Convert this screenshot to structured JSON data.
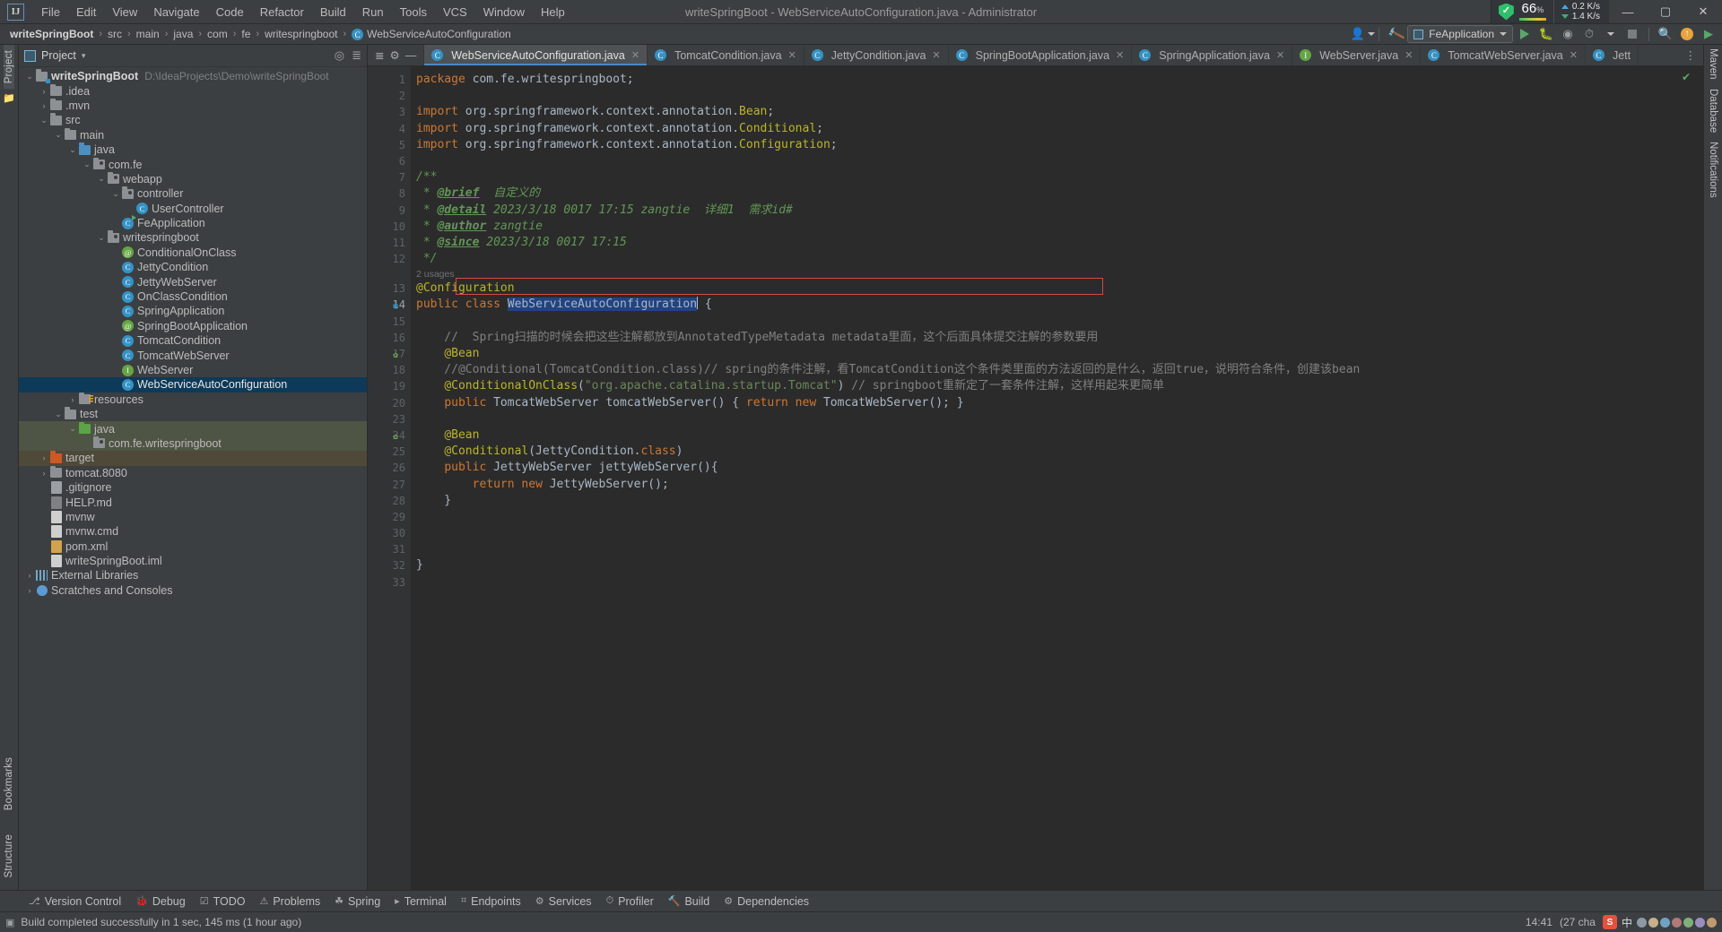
{
  "window": {
    "title": "writeSpringBoot - WebServiceAutoConfiguration.java - Administrator",
    "minimize": "—",
    "maximize": "▢",
    "close": "✕"
  },
  "menu": [
    "File",
    "Edit",
    "View",
    "Navigate",
    "Code",
    "Refactor",
    "Build",
    "Run",
    "Tools",
    "VCS",
    "Window",
    "Help"
  ],
  "system_widgets": {
    "security_icon": "shield-check-icon",
    "cpu_percent": "66",
    "cpu_unit": "%",
    "net_up": "0.2 K/s",
    "net_down": "1.4 K/s"
  },
  "breadcrumb": {
    "items": [
      "writeSpringBoot",
      "src",
      "main",
      "java",
      "com",
      "fe",
      "writespringboot"
    ],
    "separator": "›",
    "current_class": "WebServiceAutoConfiguration",
    "class_badge": "C"
  },
  "toolbar": {
    "user_icon": "user-dropdown-icon",
    "build_icon": "hammer-build-icon",
    "run_config": "FeApplication",
    "run": "run-icon",
    "debug": "debug-icon",
    "run_coverage": "run-with-coverage-icon",
    "profile": "profiler-icon",
    "stop": "stop-icon",
    "search": "search-everywhere-icon",
    "updates": "update-icon",
    "ide_feature": "ide-feature-icon"
  },
  "left_rail": {
    "labels": [
      "Project",
      "Bookmarks",
      "Structure"
    ]
  },
  "right_rail": {
    "labels": [
      "Maven",
      "Database",
      "Notifications"
    ]
  },
  "project_panel": {
    "title": "Project",
    "dropdown": "▾",
    "locate_icon": "locate-file-icon",
    "collapse_icon": "collapse-all-icon",
    "settings_icon": "gear-icon",
    "hide_icon": "hide-icon",
    "tree": [
      {
        "label": "writeSpringBoot",
        "path": "D:\\IdeaProjects\\Demo\\writeSpringBoot",
        "indent": 0,
        "arrow": "v",
        "icon": "module-folder",
        "bold": true
      },
      {
        "label": ".idea",
        "indent": 1,
        "arrow": ">",
        "icon": "folder"
      },
      {
        "label": ".mvn",
        "indent": 1,
        "arrow": ">",
        "icon": "folder"
      },
      {
        "label": "src",
        "indent": 1,
        "arrow": "v",
        "icon": "folder"
      },
      {
        "label": "main",
        "indent": 2,
        "arrow": "v",
        "icon": "folder"
      },
      {
        "label": "java",
        "indent": 3,
        "arrow": "v",
        "icon": "folder-blue"
      },
      {
        "label": "com.fe",
        "indent": 4,
        "arrow": "v",
        "icon": "package"
      },
      {
        "label": "webapp",
        "indent": 5,
        "arrow": "v",
        "icon": "package"
      },
      {
        "label": "controller",
        "indent": 6,
        "arrow": "v",
        "icon": "package"
      },
      {
        "label": "UserController",
        "indent": 7,
        "arrow": "",
        "icon": "class"
      },
      {
        "label": "FeApplication",
        "indent": 6,
        "arrow": "",
        "icon": "class-runnable"
      },
      {
        "label": "writespringboot",
        "indent": 5,
        "arrow": "v",
        "icon": "package"
      },
      {
        "label": "ConditionalOnClass",
        "indent": 6,
        "arrow": "",
        "icon": "annotation"
      },
      {
        "label": "JettyCondition",
        "indent": 6,
        "arrow": "",
        "icon": "class"
      },
      {
        "label": "JettyWebServer",
        "indent": 6,
        "arrow": "",
        "icon": "class"
      },
      {
        "label": "OnClassCondition",
        "indent": 6,
        "arrow": "",
        "icon": "class"
      },
      {
        "label": "SpringApplication",
        "indent": 6,
        "arrow": "",
        "icon": "class"
      },
      {
        "label": "SpringBootApplication",
        "indent": 6,
        "arrow": "",
        "icon": "annotation"
      },
      {
        "label": "TomcatCondition",
        "indent": 6,
        "arrow": "",
        "icon": "class"
      },
      {
        "label": "TomcatWebServer",
        "indent": 6,
        "arrow": "",
        "icon": "class"
      },
      {
        "label": "WebServer",
        "indent": 6,
        "arrow": "",
        "icon": "interface"
      },
      {
        "label": "WebServiceAutoConfiguration",
        "indent": 6,
        "arrow": "",
        "icon": "class",
        "selected": true
      },
      {
        "label": "resources",
        "indent": 3,
        "arrow": ">",
        "icon": "folder-resources"
      },
      {
        "label": "test",
        "indent": 2,
        "arrow": "v",
        "icon": "folder"
      },
      {
        "label": "java",
        "indent": 3,
        "arrow": "v",
        "icon": "folder-green",
        "greenbg": true
      },
      {
        "label": "com.fe.writespringboot",
        "indent": 4,
        "arrow": "",
        "icon": "package",
        "greenbg": true
      },
      {
        "label": "target",
        "indent": 1,
        "arrow": ">",
        "icon": "folder-orange",
        "brownbg": true
      },
      {
        "label": "tomcat.8080",
        "indent": 1,
        "arrow": ">",
        "icon": "folder"
      },
      {
        "label": ".gitignore",
        "indent": 1,
        "arrow": "",
        "icon": "file-git"
      },
      {
        "label": "HELP.md",
        "indent": 1,
        "arrow": "",
        "icon": "file-md"
      },
      {
        "label": "mvnw",
        "indent": 1,
        "arrow": "",
        "icon": "file"
      },
      {
        "label": "mvnw.cmd",
        "indent": 1,
        "arrow": "",
        "icon": "file"
      },
      {
        "label": "pom.xml",
        "indent": 1,
        "arrow": "",
        "icon": "file-xml"
      },
      {
        "label": "writeSpringBoot.iml",
        "indent": 1,
        "arrow": "",
        "icon": "file"
      },
      {
        "label": "External Libraries",
        "indent": 0,
        "arrow": ">",
        "icon": "libraries"
      },
      {
        "label": "Scratches and Consoles",
        "indent": 0,
        "arrow": ">",
        "icon": "scratches"
      }
    ]
  },
  "editor": {
    "tabs": [
      {
        "label": "WebServiceAutoConfiguration.java",
        "icon": "C",
        "active": true,
        "close": "✕"
      },
      {
        "label": "TomcatCondition.java",
        "icon": "C",
        "active": false,
        "close": "✕"
      },
      {
        "label": "JettyCondition.java",
        "icon": "C",
        "active": false,
        "close": "✕"
      },
      {
        "label": "SpringBootApplication.java",
        "icon": "C",
        "active": false,
        "close": "✕"
      },
      {
        "label": "SpringApplication.java",
        "icon": "C",
        "active": false,
        "close": "✕"
      },
      {
        "label": "WebServer.java",
        "icon": "I",
        "active": false,
        "close": "✕"
      },
      {
        "label": "TomcatWebServer.java",
        "icon": "C",
        "active": false,
        "close": "✕"
      },
      {
        "label": "Jett",
        "icon": "C",
        "active": false,
        "close": ""
      }
    ],
    "tab_overflow": "⋮",
    "inspection_status": "✔",
    "usages_hint": "2 usages",
    "selected_identifier": "WebServiceAutoConfiguration",
    "line_numbers": [
      "1",
      "2",
      "3",
      "4",
      "5",
      "6",
      "7",
      "8",
      "9",
      "10",
      "11",
      "12",
      "13",
      "14",
      "15",
      "16",
      "17",
      "18",
      "19",
      "20",
      "23",
      "24",
      "25",
      "26",
      "27",
      "28",
      "29",
      "30",
      "31",
      "32",
      "33"
    ],
    "lines": [
      {
        "n": 1,
        "segs": [
          {
            "t": "package ",
            "c": "kw"
          },
          {
            "t": "com.fe.writespringboot;",
            "c": "id"
          }
        ]
      },
      {
        "n": 2,
        "segs": []
      },
      {
        "n": 3,
        "segs": [
          {
            "t": "import ",
            "c": "kw"
          },
          {
            "t": "org.springframework.context.annotation.",
            "c": "id"
          },
          {
            "t": "Bean",
            "c": "ann"
          },
          {
            "t": ";",
            "c": "id"
          }
        ]
      },
      {
        "n": 4,
        "segs": [
          {
            "t": "import ",
            "c": "kw"
          },
          {
            "t": "org.springframework.context.annotation.",
            "c": "id"
          },
          {
            "t": "Conditional",
            "c": "ann"
          },
          {
            "t": ";",
            "c": "id"
          }
        ]
      },
      {
        "n": 5,
        "segs": [
          {
            "t": "import ",
            "c": "kw"
          },
          {
            "t": "org.springframework.context.annotation.",
            "c": "id"
          },
          {
            "t": "Configuration",
            "c": "ann"
          },
          {
            "t": ";",
            "c": "id"
          }
        ]
      },
      {
        "n": 6,
        "segs": []
      },
      {
        "n": 7,
        "segs": [
          {
            "t": "/**",
            "c": "doc"
          }
        ]
      },
      {
        "n": 8,
        "segs": [
          {
            "t": " * ",
            "c": "doc"
          },
          {
            "t": "@brief",
            "c": "doctag"
          },
          {
            "t": "  自定义的",
            "c": "doc"
          }
        ]
      },
      {
        "n": 9,
        "segs": [
          {
            "t": " * ",
            "c": "doc"
          },
          {
            "t": "@detail",
            "c": "doctag"
          },
          {
            "t": " 2023/3/18 0017 17:15 zangtie  详细1  需求id#",
            "c": "doc"
          }
        ]
      },
      {
        "n": 10,
        "segs": [
          {
            "t": " * ",
            "c": "doc"
          },
          {
            "t": "@author",
            "c": "doctag"
          },
          {
            "t": " zangtie",
            "c": "doc"
          }
        ]
      },
      {
        "n": 11,
        "segs": [
          {
            "t": " * ",
            "c": "doc"
          },
          {
            "t": "@since",
            "c": "doctag"
          },
          {
            "t": " 2023/3/18 0017 17:15",
            "c": "doc"
          }
        ]
      },
      {
        "n": 12,
        "segs": [
          {
            "t": " */",
            "c": "doc"
          }
        ]
      },
      {
        "n": 13,
        "segs": [
          {
            "t": "@Configuration",
            "c": "ann"
          }
        ]
      },
      {
        "n": 14,
        "segs": [
          {
            "t": "public ",
            "c": "kw"
          },
          {
            "t": "class ",
            "c": "kw"
          },
          {
            "t": "WebServiceAutoConfiguration",
            "c": "sel"
          },
          {
            "t": " {",
            "c": "id"
          }
        ]
      },
      {
        "n": 15,
        "segs": []
      },
      {
        "n": 16,
        "segs": [
          {
            "t": "    //  Spring扫描的时候会把这些注解都放到AnnotatedTypeMetadata metadata里面，这个后面具体提交注解的参数要用",
            "c": "cmt"
          }
        ]
      },
      {
        "n": 17,
        "segs": [
          {
            "t": "    ",
            "c": "id"
          },
          {
            "t": "@Bean",
            "c": "ann"
          }
        ]
      },
      {
        "n": 18,
        "segs": [
          {
            "t": "    //@Conditional(TomcatCondition.class)// spring的条件注解，看TomcatCondition这个条件类里面的方法返回的是什么，返回true，说明符合条件，创建该bean",
            "c": "cmt"
          }
        ]
      },
      {
        "n": 19,
        "segs": [
          {
            "t": "    ",
            "c": "id"
          },
          {
            "t": "@ConditionalOnClass",
            "c": "ann"
          },
          {
            "t": "(",
            "c": "id"
          },
          {
            "t": "\"org.apache.catalina.startup.Tomcat\"",
            "c": "str"
          },
          {
            "t": ")",
            "c": "id"
          },
          {
            "t": " // springboot重新定了一套条件注解，这样用起来更简单",
            "c": "cmt"
          }
        ]
      },
      {
        "n": 20,
        "segs": [
          {
            "t": "    ",
            "c": "id"
          },
          {
            "t": "public ",
            "c": "kw"
          },
          {
            "t": "TomcatWebServer tomcatWebServer",
            "c": "id"
          },
          {
            "t": "() { ",
            "c": "id"
          },
          {
            "t": "return new ",
            "c": "kw"
          },
          {
            "t": "TomcatWebServer(); }",
            "c": "id"
          }
        ]
      },
      {
        "n": 23,
        "segs": []
      },
      {
        "n": 24,
        "segs": [
          {
            "t": "    ",
            "c": "id"
          },
          {
            "t": "@Bean",
            "c": "ann"
          }
        ]
      },
      {
        "n": 25,
        "segs": [
          {
            "t": "    ",
            "c": "id"
          },
          {
            "t": "@Conditional",
            "c": "ann"
          },
          {
            "t": "(JettyCondition.",
            "c": "id"
          },
          {
            "t": "class",
            "c": "kw"
          },
          {
            "t": ")",
            "c": "id"
          }
        ]
      },
      {
        "n": 26,
        "segs": [
          {
            "t": "    ",
            "c": "id"
          },
          {
            "t": "public ",
            "c": "kw"
          },
          {
            "t": "JettyWebServer jettyWebServer(){",
            "c": "id"
          }
        ]
      },
      {
        "n": 27,
        "segs": [
          {
            "t": "        ",
            "c": "id"
          },
          {
            "t": "return new ",
            "c": "kw"
          },
          {
            "t": "JettyWebServer();",
            "c": "id"
          }
        ]
      },
      {
        "n": 28,
        "segs": [
          {
            "t": "    }",
            "c": "id"
          }
        ]
      },
      {
        "n": 29,
        "segs": []
      },
      {
        "n": 30,
        "segs": []
      },
      {
        "n": 31,
        "segs": []
      },
      {
        "n": 32,
        "segs": [
          {
            "t": "}",
            "c": "id"
          }
        ]
      },
      {
        "n": 33,
        "segs": []
      }
    ]
  },
  "tool_windows": [
    {
      "label": "Version Control",
      "icon": "version-control-icon"
    },
    {
      "label": "Debug",
      "icon": "debug-icon"
    },
    {
      "label": "TODO",
      "icon": "todo-icon"
    },
    {
      "label": "Problems",
      "icon": "problems-icon"
    },
    {
      "label": "Spring",
      "icon": "spring-icon"
    },
    {
      "label": "Terminal",
      "icon": "terminal-icon"
    },
    {
      "label": "Endpoints",
      "icon": "endpoints-icon"
    },
    {
      "label": "Services",
      "icon": "services-icon"
    },
    {
      "label": "Profiler",
      "icon": "profiler-icon"
    },
    {
      "label": "Build",
      "icon": "build-icon"
    },
    {
      "label": "Dependencies",
      "icon": "dependencies-icon"
    }
  ],
  "status_bar": {
    "message": "Build completed successfully in 1 sec, 145 ms (1 hour ago)",
    "icon": "build-status-icon",
    "clock": "14:41",
    "chars": "(27 cha",
    "ime_lang": "中",
    "tray_logo": "S"
  }
}
